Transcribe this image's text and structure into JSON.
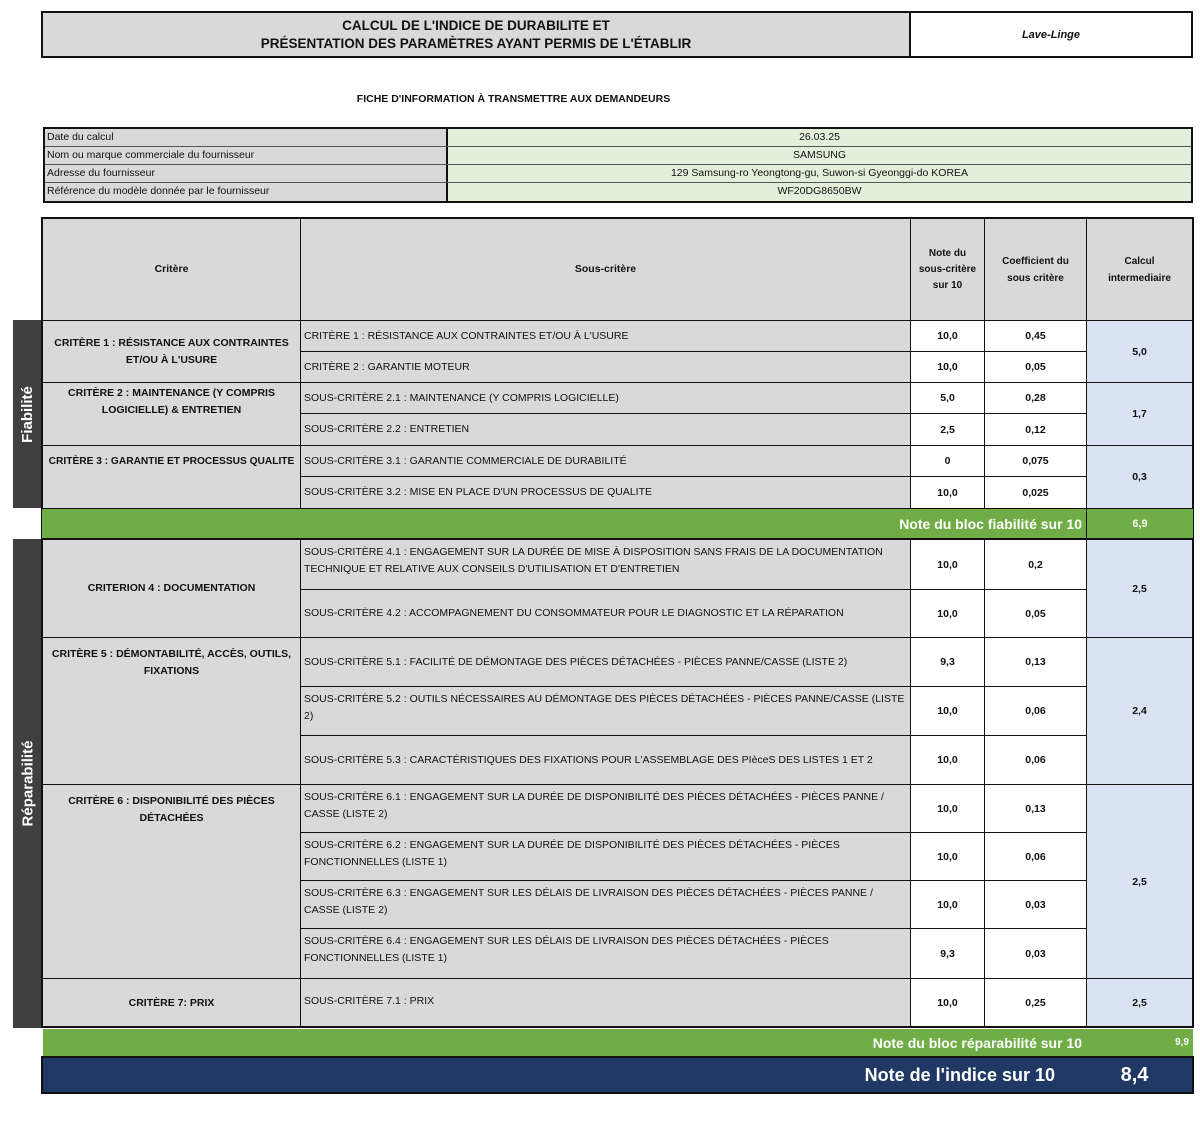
{
  "header": {
    "title_line1": "CALCUL DE L'INDICE DE DURABILITE ET",
    "title_line2": "PRÉSENTATION DES PARAMÈTRES AYANT PERMIS DE L'ÉTABLIR",
    "product": "Lave-Linge"
  },
  "subtitle": "FICHE D'INFORMATION À TRANSMETTRE AUX DEMANDEURS",
  "info": [
    {
      "label": "Date du calcul",
      "value": "26.03.25"
    },
    {
      "label": "Nom ou marque commerciale du fournisseur",
      "value": "SAMSUNG"
    },
    {
      "label": "Adresse du fournisseur",
      "value": "129 Samsung-ro Yeongtong-gu, Suwon-si Gyeonggi-do KOREA"
    },
    {
      "label": "Référence du modèle donnée par le fournisseur",
      "value": "WF20DG8650BW"
    }
  ],
  "columns": {
    "critere": "Critère",
    "sous_critere": "Sous-critère",
    "note_l1": "Note du",
    "note_l2": "sous-critère",
    "note_l3": "sur 10",
    "coef_l1": "Coefficient du",
    "coef_l2": "sous critère",
    "calc_l1": "Calcul",
    "calc_l2": "intermediaire"
  },
  "sections": {
    "fiabilite": "Fiabilité",
    "reparabilite": "Réparabilité"
  },
  "criteria": {
    "c1": "CRITÈRE 1 : RÉSISTANCE AUX CONTRAINTES ET/OU À L'USURE",
    "c2": "CRITÈRE 2 : MAINTENANCE (Y COMPRIS LOGICIELLE) & ENTRETIEN",
    "c3": "CRITÈRE 3 : GARANTIE ET PROCESSUS QUALITE",
    "c4": "CRITERION 4 : DOCUMENTATION",
    "c5": "CRITÈRE 5 : DÉMONTABILITÉ, ACCÈS, OUTILS, FIXATIONS",
    "c6": "CRITÈRE 6 : DISPONIBILITÉ DES PIÈCES DÉTACHÉES",
    "c7": "CRITÈRE 7: PRIX"
  },
  "rows": [
    {
      "label": "CRITÈRE 1 : RÉSISTANCE AUX CONTRAINTES ET/OU À L'USURE",
      "note": "10,0",
      "coef": "0,45"
    },
    {
      "label": "CRITÈRE 2 : GARANTIE MOTEUR",
      "note": "10,0",
      "coef": "0,05"
    },
    {
      "label": "SOUS-CRITÈRE 2.1 : MAINTENANCE (Y COMPRIS LOGICIELLE)",
      "note": "5,0",
      "coef": "0,28"
    },
    {
      "label": "SOUS-CRITÈRE 2.2 : ENTRETIEN",
      "note": "2,5",
      "coef": "0,12"
    },
    {
      "label": "SOUS-CRITÈRE 3.1 : GARANTIE COMMERCIALE DE DURABILITÉ",
      "note": "0",
      "coef": "0,075"
    },
    {
      "label": "SOUS-CRITÈRE 3.2 : MISE EN PLACE D'UN PROCESSUS DE QUALITE",
      "note": "10,0",
      "coef": "0,025"
    },
    {
      "label": "SOUS-CRITÈRE 4.1 : ENGAGEMENT SUR LA DURÉE DE MISE À DISPOSITION SANS FRAIS DE LA DOCUMENTATION TECHNIQUE ET RELATIVE AUX CONSEILS D'UTILISATION ET D'ENTRETIEN",
      "note": "10,0",
      "coef": "0,2"
    },
    {
      "label": "SOUS-CRITÈRE 4.2 : ACCOMPAGNEMENT DU CONSOMMATEUR POUR LE DIAGNOSTIC ET LA RÉPARATION",
      "note": "10,0",
      "coef": "0,05"
    },
    {
      "label": "SOUS-CRITÈRE 5.1 : FACILITÉ DE DÉMONTAGE DES PIÈCES DÉTACHÉES - PIÈCES PANNE/CASSE (LISTE 2)",
      "note": "9,3",
      "coef": "0,13"
    },
    {
      "label": "SOUS-CRITÈRE 5.2 : OUTILS NÉCESSAIRES AU DÉMONTAGE DES PIÈCES DÉTACHÉES - PIÈCES PANNE/CASSE (LISTE 2)",
      "note": "10,0",
      "coef": "0,06"
    },
    {
      "label": "SOUS-CRITÈRE 5.3 : CARACTÉRISTIQUES DES FIXATIONS POUR L'ASSEMBLAGE DES PIèceS DES LISTES 1 ET 2",
      "note": "10,0",
      "coef": "0,06"
    },
    {
      "label": "SOUS-CRITÈRE 6.1 : ENGAGEMENT SUR LA DURÉE DE DISPONIBILITÉ DES PIÈCES DÉTACHÉES - PIÈCES PANNE / CASSE (LISTE 2)",
      "note": "10,0",
      "coef": "0,13"
    },
    {
      "label": "SOUS-CRITÈRE 6.2 : ENGAGEMENT SUR LA DURÉE DE DISPONIBILITÉ DES PIÈCES DÉTACHÉES - PIÈCES FONCTIONNELLES (LISTE 1)",
      "note": "10,0",
      "coef": "0,06"
    },
    {
      "label": "SOUS-CRITÈRE 6.3 : ENGAGEMENT SUR LES DÉLAIS DE LIVRAISON DES PIÈCES DÉTACHÉES - PIÈCES PANNE / CASSE (LISTE 2)",
      "note": "10,0",
      "coef": "0,03"
    },
    {
      "label": "SOUS-CRITÈRE 6.4 : ENGAGEMENT SUR LES DÉLAIS DE LIVRAISON DES PIÈCES DÉTACHÉES - PIÈCES FONCTIONNELLES (LISTE 1)",
      "note": "9,3",
      "coef": "0,03"
    },
    {
      "label": "SOUS-CRITÈRE 7.1 : PRIX",
      "note": "10,0",
      "coef": "0,25"
    }
  ],
  "calc": {
    "c1": "5,0",
    "c2": "1,7",
    "c3": "0,3",
    "c4": "2,5",
    "c5": "2,4",
    "c6": "2,5",
    "c7": "2,5"
  },
  "totals": {
    "fiabilite_label": "Note du bloc fiabilité sur 10",
    "fiabilite_value": "6,9",
    "reparabilite_label": "Note du bloc réparabilité sur 10",
    "reparabilite_value": "9,9",
    "indice_label": "Note de l'indice sur 10",
    "indice_value": "8,4"
  },
  "colors": {
    "header_grey": "#d9d9d9",
    "info_green": "#e2efda",
    "calc_blue": "#dae3f3",
    "total_green": "#70ad47",
    "final_navy": "#203864",
    "side_dark": "#404040"
  }
}
